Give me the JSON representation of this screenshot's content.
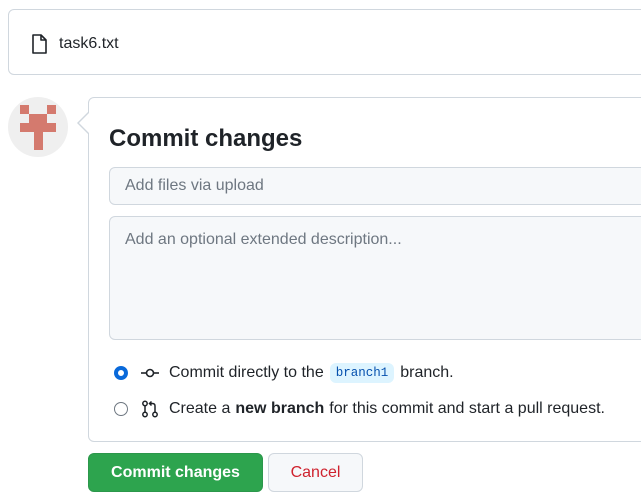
{
  "file": {
    "icon": "file-icon",
    "name": "task6.txt"
  },
  "avatar": {
    "icon": "identicon-avatar"
  },
  "commit_form": {
    "title": "Commit changes",
    "summary_placeholder": "Add files via upload",
    "description_placeholder": "Add an optional extended description...",
    "options": [
      {
        "icon": "git-commit-icon",
        "checked": true,
        "text_before": "Commit directly to the",
        "branch": "branch1",
        "text_after": "branch."
      },
      {
        "icon": "git-pull-request-icon",
        "checked": false,
        "text_before": "Create a",
        "bold": "new branch",
        "text_after": "for this commit and start a pull request."
      }
    ]
  },
  "buttons": {
    "commit": "Commit changes",
    "cancel": "Cancel"
  },
  "colors": {
    "primary_green": "#2da44e",
    "radio_blue": "#0969da",
    "cancel_red": "#cf222e",
    "border": "#d0d7de",
    "avatar_red": "#d47a6e"
  }
}
